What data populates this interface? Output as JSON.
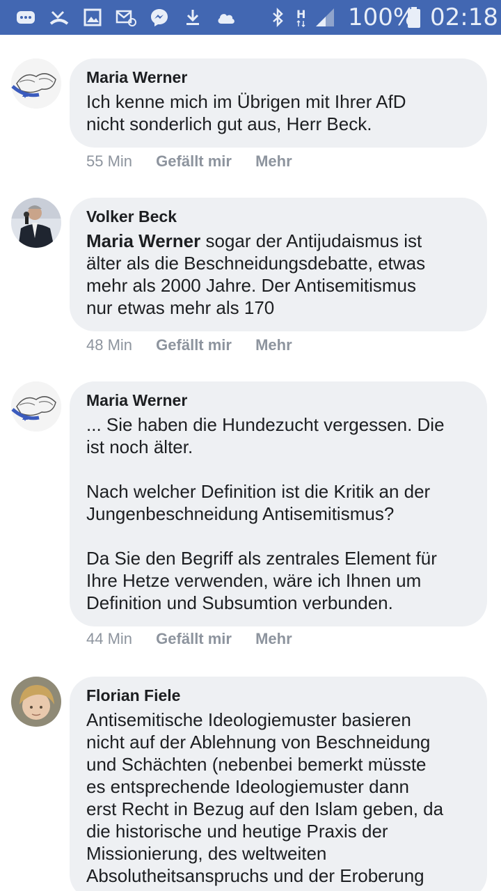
{
  "status_bar": {
    "battery_percent": "100%",
    "time": "02:18",
    "network_type": "H",
    "icons": [
      "messages-icon",
      "missed-call-icon",
      "gallery-icon",
      "email-icon",
      "messenger-icon",
      "download-icon",
      "cloud-icon",
      "bluetooth-icon",
      "signal-icon",
      "battery-icon"
    ]
  },
  "comments": [
    {
      "author": "Maria Werner",
      "mention": "",
      "text": "Ich kenne mich im Übrigen mit Ihrer AfD\nnicht sonderlich gut aus, Herr Beck.",
      "time": "55 Min",
      "like_label": "Gefällt mir",
      "more_label": "Mehr"
    },
    {
      "author": "Volker Beck",
      "mention": "Maria Werner",
      "text": " sogar der Antijudaismus ist\nälter als die Beschneidungsdebatte, etwas\nmehr als 2000 Jahre. Der Antisemitismus\nnur etwas mehr als 170",
      "time": "48 Min",
      "like_label": "Gefällt mir",
      "more_label": "Mehr"
    },
    {
      "author": "Maria Werner",
      "mention": "",
      "text": "... Sie haben die Hundezucht vergessen. Die\nist noch älter.\n\nNach welcher Definition ist die Kritik an der\nJungenbeschneidung Antisemitismus?\n\nDa Sie den Begriff als zentrales Element für\nIhre Hetze verwenden, wäre ich Ihnen um\nDefinition und Subsumtion verbunden.",
      "time": "44 Min",
      "like_label": "Gefällt mir",
      "more_label": "Mehr"
    },
    {
      "author": "Florian Fiele",
      "mention": "",
      "text": "Antisemitische Ideologiemuster basieren\nnicht auf der Ablehnung von Beschneidung\nund Schächten (nebenbei bemerkt müsste\nes entsprechende Ideologiemuster dann\nerst Recht in Bezug auf den Islam geben, da\ndie historische und heutige Praxis der\nMissionierung, des weltweiten\nAbsolutheitsanspruchs und der Eroberung",
      "time": "",
      "like_label": "",
      "more_label": ""
    }
  ],
  "colors": {
    "status_bar": "#4267b2",
    "bubble": "#eef0f3",
    "meta_text": "#8d949e",
    "text": "#1c1e21"
  }
}
